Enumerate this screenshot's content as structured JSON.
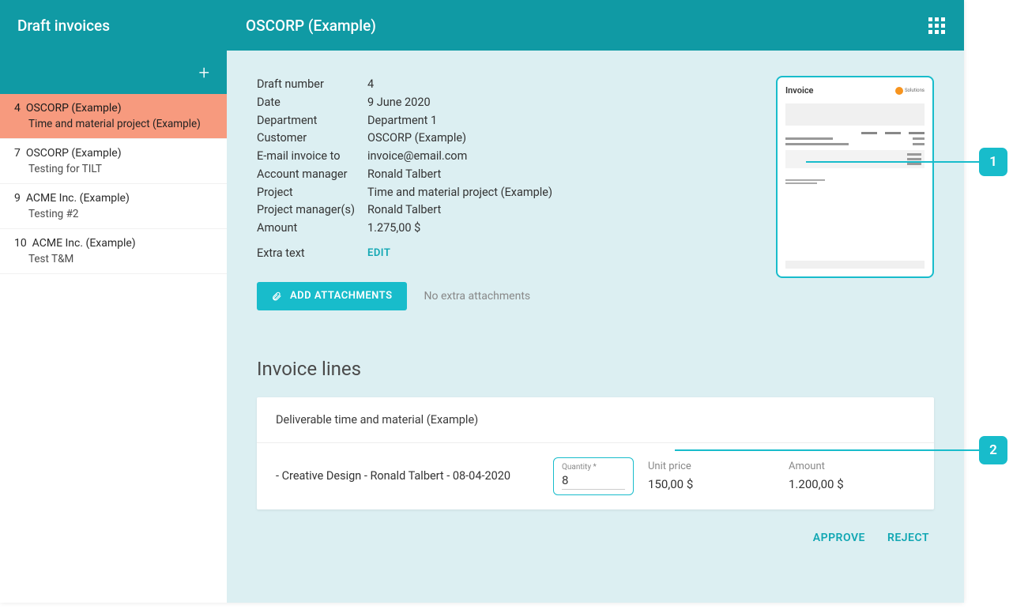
{
  "sidebar": {
    "title": "Draft invoices",
    "items": [
      {
        "num": "4",
        "name": "OSCORP (Example)",
        "sub": "Time and material project (Example)",
        "selected": true
      },
      {
        "num": "7",
        "name": "OSCORP (Example)",
        "sub": "Testing for TILT",
        "selected": false
      },
      {
        "num": "9",
        "name": "ACME Inc. (Example)",
        "sub": "Testing #2",
        "selected": false
      },
      {
        "num": "10",
        "name": "ACME Inc. (Example)",
        "sub": "Test T&M",
        "selected": false
      }
    ]
  },
  "header": {
    "title": "OSCORP (Example)"
  },
  "details": {
    "rows": [
      {
        "k": "Draft number",
        "v": "4"
      },
      {
        "k": "Date",
        "v": "9 June 2020"
      },
      {
        "k": "Department",
        "v": "Department 1"
      },
      {
        "k": "Customer",
        "v": "OSCORP (Example)"
      },
      {
        "k": "E-mail invoice to",
        "v": "invoice@email.com"
      },
      {
        "k": "Account manager",
        "v": "Ronald Talbert"
      },
      {
        "k": "Project",
        "v": "Time and material project (Example)"
      },
      {
        "k": "Project manager(s)",
        "v": "Ronald Talbert"
      },
      {
        "k": "Amount",
        "v": "1.275,00 $"
      }
    ],
    "extra_label": "Extra text",
    "edit_label": "EDIT"
  },
  "attachments": {
    "button": "ADD ATTACHMENTS",
    "empty": "No extra attachments"
  },
  "preview": {
    "title": "Invoice",
    "brand": "Solutions"
  },
  "lines": {
    "title": "Invoice lines",
    "group": "Deliverable time and material (Example)",
    "row": {
      "desc": "- Creative Design - Ronald Talbert - 08-04-2020",
      "qty_label": "Quantity *",
      "qty": "8",
      "unit_label": "Unit price",
      "unit": "150,00 $",
      "amount_label": "Amount",
      "amount": "1.200,00 $"
    }
  },
  "actions": {
    "approve": "APPROVE",
    "reject": "REJECT"
  },
  "callouts": {
    "c1": "1",
    "c2": "2"
  }
}
